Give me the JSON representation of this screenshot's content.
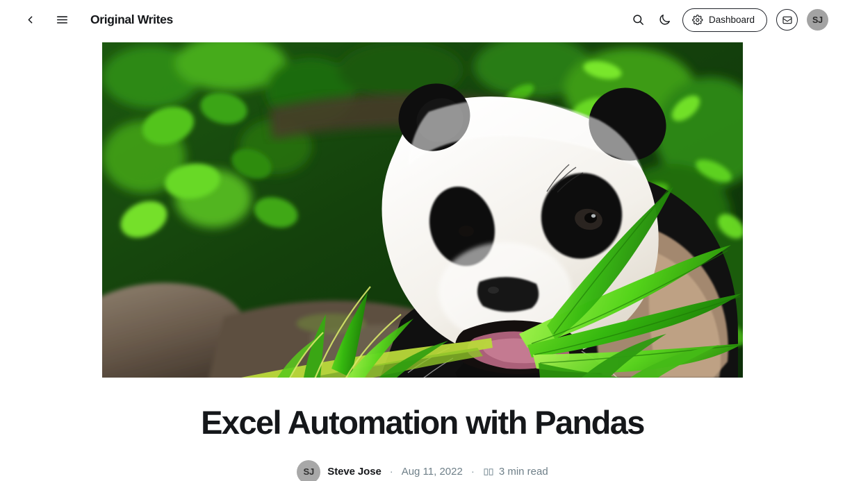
{
  "header": {
    "back_label": "Back",
    "back_icon": "chevron-left-icon",
    "menu_icon": "hamburger-menu-icon",
    "site_title": "Original Writes",
    "search_icon": "search-icon",
    "darkmode_icon": "moon-icon",
    "dashboard_label": "Dashboard",
    "dashboard_icon": "gear-icon",
    "mail_icon": "envelope-icon",
    "avatar_initials": "SJ"
  },
  "article": {
    "hero_alt": "Giant panda eating bamboo leaves in green foliage",
    "title": "Excel Automation with Pandas",
    "author": {
      "initials": "SJ",
      "name": "Steve Jose"
    },
    "separator": "·",
    "date": "Aug 11, 2022",
    "readtime": "3 min read",
    "readtime_icon": "open-book-icon"
  },
  "colors": {
    "text": "#15171a",
    "muted": "#6e7f88",
    "avatar_bg": "#a3a3a3",
    "border": "#20232a",
    "background": "#ffffff"
  }
}
